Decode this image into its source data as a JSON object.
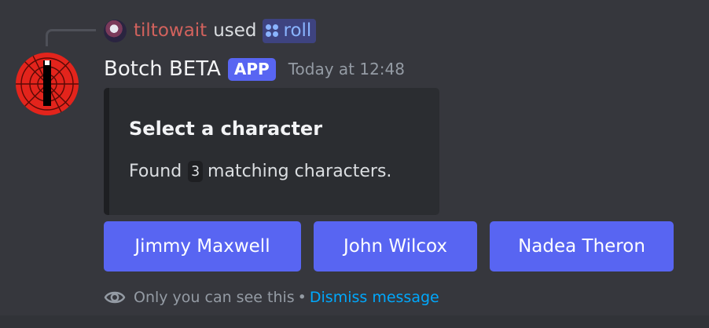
{
  "reply": {
    "username": "tiltowait",
    "used_text": "used",
    "command": "roll",
    "command_icon": "slash-command-icon",
    "username_color": "#d2625d"
  },
  "message": {
    "bot_name": "Botch BETA",
    "badge": "APP",
    "timestamp": "Today at 12:48",
    "avatar_icon": "red-spiderweb-avatar",
    "badge_color": "#5865f2"
  },
  "embed": {
    "title": "Select a character",
    "description_prefix": "Found",
    "count": "3",
    "description_suffix": "matching characters."
  },
  "buttons": [
    {
      "label": "Jimmy Maxwell"
    },
    {
      "label": "John Wilcox"
    },
    {
      "label": "Nadea Theron"
    }
  ],
  "button_color": "#5865f2",
  "footer": {
    "notice": "Only you can see this",
    "separator": "•",
    "dismiss": "Dismiss message",
    "eye_icon": "eye-icon"
  }
}
